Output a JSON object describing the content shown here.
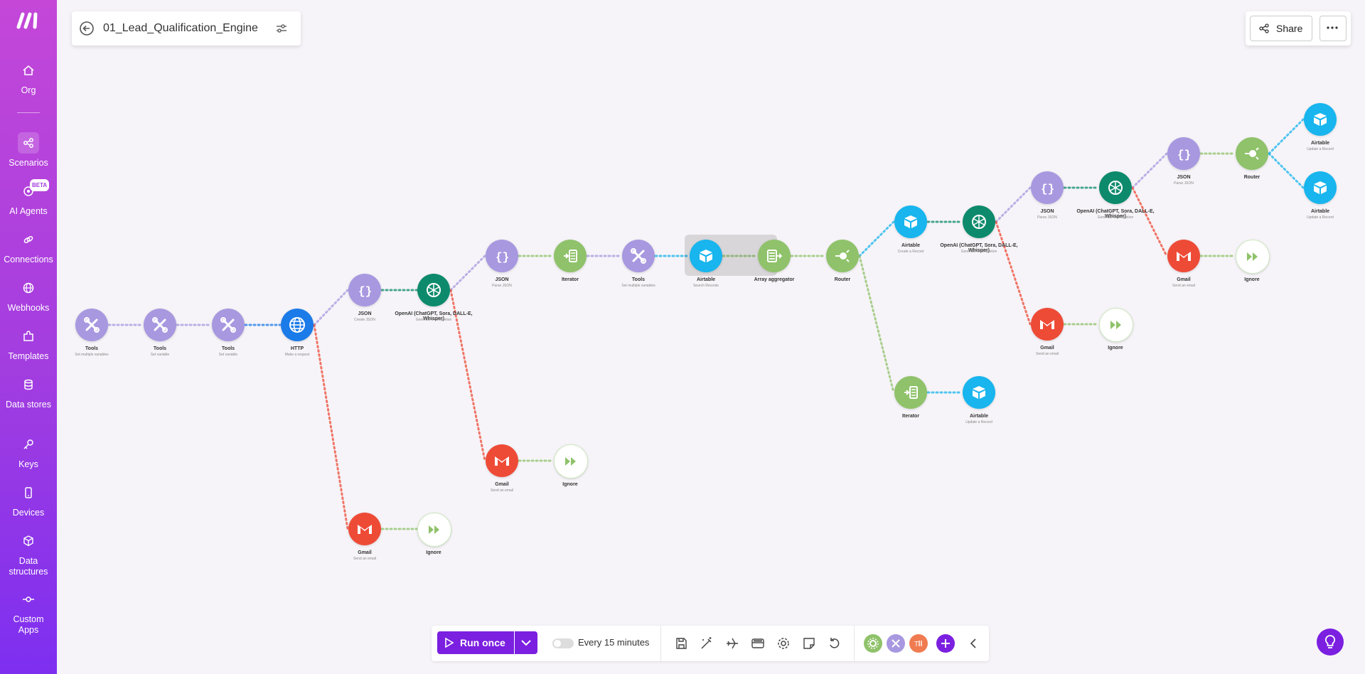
{
  "sidebar": {
    "items": [
      {
        "label": "Org",
        "icon": "home-icon"
      },
      {
        "label": "Scenarios",
        "icon": "share-nodes-icon"
      },
      {
        "label": "AI Agents",
        "icon": "ai-agent-icon",
        "badge": "BETA"
      },
      {
        "label": "Connections",
        "icon": "link-icon"
      },
      {
        "label": "Webhooks",
        "icon": "globe-icon"
      },
      {
        "label": "Templates",
        "icon": "puzzle-icon"
      },
      {
        "label": "Data stores",
        "icon": "database-icon"
      },
      {
        "label": "Keys",
        "icon": "key-icon"
      },
      {
        "label": "Devices",
        "icon": "phone-icon"
      },
      {
        "label": "Data structures",
        "icon": "cube-icon"
      },
      {
        "label": "Custom Apps",
        "icon": "custom-apps-icon"
      }
    ]
  },
  "header": {
    "scenario_name": "01_Lead_Qualification_Engine",
    "share_label": "Share",
    "more_label": "···"
  },
  "toolbar": {
    "run_label": "Run once",
    "schedule_label": "Every 15 minutes"
  },
  "nodes": [
    {
      "id": "n1",
      "label": "Tools",
      "sub": "Set multiple variables",
      "type": "tools"
    },
    {
      "id": "n2",
      "label": "Tools",
      "sub": "Set variable",
      "type": "tools"
    },
    {
      "id": "n3",
      "label": "Tools",
      "sub": "Set variable",
      "type": "tools"
    },
    {
      "id": "n4",
      "label": "HTTP",
      "sub": "Make a request",
      "type": "http"
    },
    {
      "id": "n5",
      "label": "JSON",
      "sub": "Create JSON",
      "type": "json"
    },
    {
      "id": "n6",
      "label": "OpenAI (ChatGPT, Sora, DALL-E, Whisper)",
      "sub": "Generate a completion",
      "type": "openai"
    },
    {
      "id": "n7",
      "label": "JSON",
      "sub": "Parse JSON",
      "type": "json"
    },
    {
      "id": "n8",
      "label": "Iterator",
      "sub": "",
      "type": "iterator"
    },
    {
      "id": "n9",
      "label": "Tools",
      "sub": "Set multiple variables",
      "type": "tools"
    },
    {
      "id": "n10",
      "label": "Airtable",
      "sub": "Search Records",
      "type": "airtable"
    },
    {
      "id": "n11",
      "label": "Array aggregator",
      "sub": "",
      "type": "aggregator"
    },
    {
      "id": "n12",
      "label": "Router",
      "sub": "",
      "type": "router"
    },
    {
      "id": "n13",
      "label": "Airtable",
      "sub": "Create a Record",
      "type": "airtable"
    },
    {
      "id": "n14",
      "label": "OpenAI (ChatGPT, Sora, DALL-E, Whisper)",
      "sub": "Generate a completion",
      "type": "openai"
    },
    {
      "id": "n15",
      "label": "JSON",
      "sub": "Parse JSON",
      "type": "json"
    },
    {
      "id": "n16",
      "label": "OpenAI (ChatGPT, Sora, DALL-E, Whisper)",
      "sub": "Generate a completion",
      "type": "openai"
    },
    {
      "id": "n17",
      "label": "JSON",
      "sub": "Parse JSON",
      "type": "json"
    },
    {
      "id": "n18",
      "label": "Router",
      "sub": "",
      "type": "router"
    },
    {
      "id": "n19",
      "label": "Airtable",
      "sub": "Update a Record",
      "type": "airtable"
    },
    {
      "id": "n20",
      "label": "Airtable",
      "sub": "Update a Record",
      "type": "airtable"
    },
    {
      "id": "n21",
      "label": "Gmail",
      "sub": "Send an email",
      "type": "gmail"
    },
    {
      "id": "n22",
      "label": "Ignore",
      "sub": "",
      "type": "ignore"
    },
    {
      "id": "n23",
      "label": "Gmail",
      "sub": "Send an email",
      "type": "gmail"
    },
    {
      "id": "n24",
      "label": "Ignore",
      "sub": "",
      "type": "ignore"
    },
    {
      "id": "n25",
      "label": "Iterator",
      "sub": "",
      "type": "iterator"
    },
    {
      "id": "n26",
      "label": "Airtable",
      "sub": "Update a Record",
      "type": "airtable"
    },
    {
      "id": "n27",
      "label": "Gmail",
      "sub": "Send an email",
      "type": "gmail"
    },
    {
      "id": "n28",
      "label": "Ignore",
      "sub": "",
      "type": "ignore"
    },
    {
      "id": "n29",
      "label": "Gmail",
      "sub": "Send an email",
      "type": "gmail"
    },
    {
      "id": "n30",
      "label": "Ignore",
      "sub": "",
      "type": "ignore"
    }
  ],
  "colors": {
    "accent": "#7b1fe0",
    "sidebar_top": "#c447d8",
    "sidebar_bottom": "#7d2ff0",
    "tools": "#a898e0",
    "http": "#1b7be8",
    "openai": "#0d8a6c",
    "gmail": "#ee4b37",
    "airtable": "#18b5ee",
    "router": "#8fc26a"
  }
}
